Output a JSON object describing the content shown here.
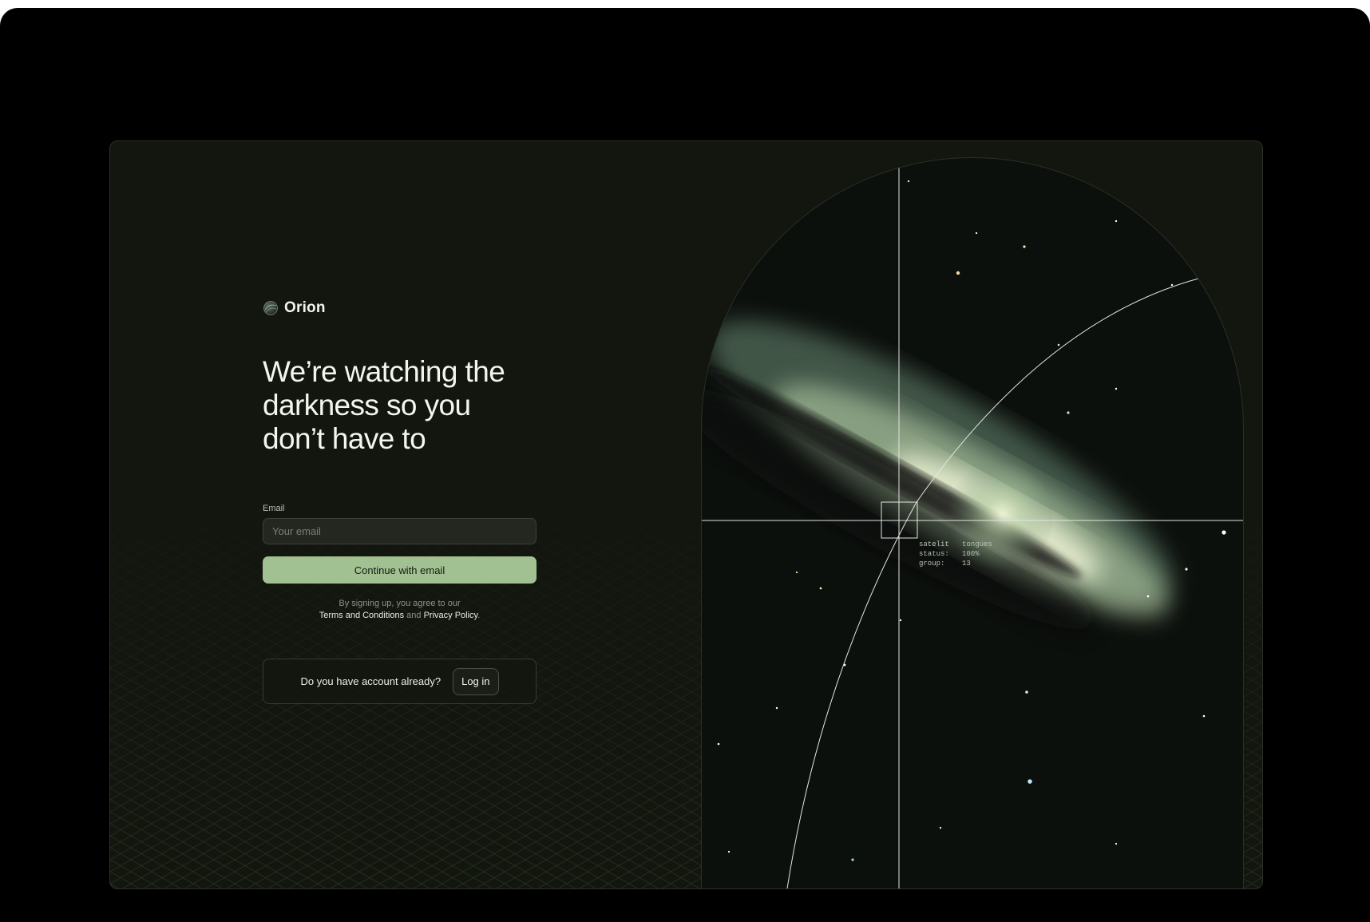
{
  "brand": {
    "name": "Orion",
    "logo_icon": "orion-globe-icon"
  },
  "headline": "We’re watching the darkness so you don’t have to",
  "form": {
    "email_label": "Email",
    "email_placeholder": "Your email",
    "email_value": "",
    "continue_label": "Continue with email"
  },
  "legal": {
    "prefix": "By signing up, you agree to our",
    "terms": "Terms and Conditions",
    "and": "and",
    "privacy": "Privacy Policy",
    "suffix": "."
  },
  "account": {
    "prompt": "Do you have account already?",
    "login_label": "Log in"
  },
  "telemetry": {
    "line1": "satelit   tongues",
    "line2": "status:   100%",
    "line3": "group:    13"
  },
  "colors": {
    "page_bg": "#000000",
    "card_bg": "#13160f",
    "accent": "#a2c192",
    "text_primary": "#f4f5f0"
  }
}
